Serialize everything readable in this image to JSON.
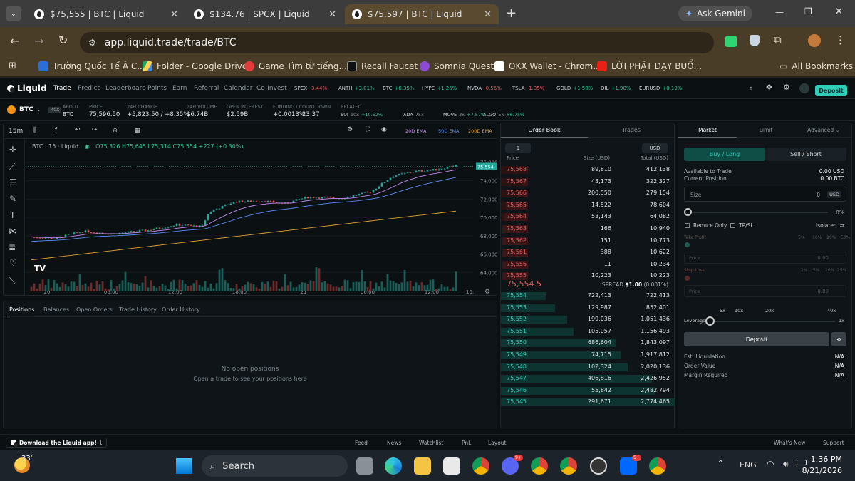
{
  "browser": {
    "tabs": [
      {
        "title": "$75,555 | BTC | Liquid"
      },
      {
        "title": "$134.76 | SPCX | Liquid"
      },
      {
        "title": "$75,597 | BTC | Liquid"
      }
    ],
    "ask_gemini": "Ask Gemini",
    "url": "app.liquid.trade/trade/BTC",
    "bookmarks": [
      "Trường Quốc Tế Á C...",
      "Folder - Google Drive",
      "Game Tìm từ tiếng...",
      "Recall Faucet",
      "Somnia Quest",
      "OKX Wallet - Chrom...",
      "LỜI PHẬT DẠY BUỔ..."
    ],
    "all_bookmarks": "All Bookmarks"
  },
  "nav": {
    "logo": "Liquid",
    "links": [
      "Trade",
      "Predict",
      "Leaderboard",
      "Points",
      "Earn",
      "Referral",
      "Calendar",
      "Co-Invest"
    ],
    "tickers": [
      {
        "sym": "SPCX",
        "chg": "-3.44%",
        "up": false
      },
      {
        "sym": "ANTH",
        "chg": "+3.01%",
        "up": true
      },
      {
        "sym": "BTC",
        "chg": "+8.35%",
        "up": true
      },
      {
        "sym": "HYPE",
        "chg": "+1.26%",
        "up": true
      },
      {
        "sym": "NVDA",
        "chg": "-0.56%",
        "up": false
      },
      {
        "sym": "TSLA",
        "chg": "-1.05%",
        "up": false
      },
      {
        "sym": "GOLD",
        "chg": "+1.58%",
        "up": true
      },
      {
        "sym": "OIL",
        "chg": "+1.90%",
        "up": true
      },
      {
        "sym": "EURUSD",
        "chg": "+0.19%",
        "up": true
      }
    ],
    "deposit": "Deposit"
  },
  "asset": {
    "sym": "BTC",
    "lev": "40X",
    "about_h": "ABOUT",
    "about_v": "BTC",
    "price_h": "PRICE",
    "price_v": "75,596.50",
    "chg_h": "24H CHANGE",
    "chg_v": "+5,823.50 / +8.35%",
    "vol_h": "24H VOLUME",
    "vol_v": "$6.74B",
    "oi_h": "OPEN INTEREST",
    "oi_v": "$2.59B",
    "fund_h": "FUNDING / COUNTDOWN",
    "fund_v": "+0.0013%",
    "fund_cd": "23:37",
    "rel_h": "RELATED",
    "related": [
      {
        "sym": "SUI",
        "lev": "10x",
        "chg": "+10.52%",
        "up": true
      },
      {
        "sym": "ADA",
        "lev": "75x",
        "chg": "",
        "up": true
      },
      {
        "sym": "MOVE",
        "lev": "3x",
        "chg": "+7.57%",
        "up": true
      },
      {
        "sym": "ALGO",
        "lev": "5x",
        "chg": "+6.75%",
        "up": true
      }
    ]
  },
  "chart": {
    "timeframe": "15m",
    "legend_title": "BTC · 15 · Liquid",
    "ohlc": "O75,326 H75,645 L75,314 C75,554 +227 (+0.30%)",
    "ema": [
      "20D EMA",
      "50D EMA",
      "200D EMA"
    ],
    "ema_colors": [
      "#c58cf0",
      "#5b8cf5",
      "#e0a23a"
    ],
    "price_tag": "75,554",
    "y_ticks": [
      "76,000",
      "74,000",
      "72,000",
      "70,000",
      "68,000",
      "66,000",
      "64,000"
    ],
    "x_ticks": [
      "20",
      "06:00",
      "12:00",
      "18:00",
      "21",
      "06:00",
      "12:00"
    ],
    "scale_label": "16:"
  },
  "bottom_tabs": [
    "Positions",
    "Balances",
    "Open Orders",
    "Trade History",
    "Order History"
  ],
  "empty": {
    "title": "No open positions",
    "sub": "Open a trade to see your positions here"
  },
  "orderbook": {
    "tabs": [
      "Order Book",
      "Trades"
    ],
    "group": "1",
    "currency": "USD",
    "cols": [
      "Price",
      "Size (USD)",
      "Total (USD)"
    ],
    "asks": [
      [
        "75,568",
        "89,810",
        "412,138",
        0.15
      ],
      [
        "75,567",
        "43,173",
        "322,327",
        0.12
      ],
      [
        "75,566",
        "200,550",
        "279,154",
        0.1
      ],
      [
        "75,565",
        "14,522",
        "78,604",
        0.03
      ],
      [
        "75,564",
        "53,143",
        "64,082",
        0.02
      ],
      [
        "75,563",
        "166",
        "10,940",
        0.0
      ],
      [
        "75,562",
        "151",
        "10,773",
        0.0
      ],
      [
        "75,561",
        "388",
        "10,622",
        0.0
      ],
      [
        "75,556",
        "11",
        "10,234",
        0.0
      ],
      [
        "75,555",
        "10,223",
        "10,223",
        0.0
      ]
    ],
    "mid": "75,554.5",
    "spread_label": "SPREAD",
    "spread_val": "$1.00",
    "spread_pct": "(0.001%)",
    "bids": [
      [
        "75,554",
        "722,413",
        "722,413",
        0.26
      ],
      [
        "75,553",
        "129,987",
        "852,401",
        0.31
      ],
      [
        "75,552",
        "199,036",
        "1,051,436",
        0.38
      ],
      [
        "75,551",
        "105,057",
        "1,156,493",
        0.42
      ],
      [
        "75,550",
        "686,604",
        "1,843,097",
        0.66
      ],
      [
        "75,549",
        "74,715",
        "1,917,812",
        0.69
      ],
      [
        "75,548",
        "102,324",
        "2,020,136",
        0.73
      ],
      [
        "75,547",
        "406,816",
        "2,426,952",
        0.87
      ],
      [
        "75,546",
        "55,842",
        "2,482,794",
        0.89
      ],
      [
        "75,545",
        "291,671",
        "2,774,465",
        1.0
      ]
    ]
  },
  "order": {
    "tabs": [
      "Market",
      "Limit",
      "Advanced"
    ],
    "buy": "Buy / Long",
    "sell": "Sell / Short",
    "avail_l": "Available to Trade",
    "avail_v": "0.00 USD",
    "pos_l": "Current Position",
    "pos_v": "0.00 BTC",
    "size_l": "Size",
    "size_v": "0",
    "size_cur": "USD",
    "slider_pct": "0%",
    "reduce": "Reduce Only",
    "tpsl": "TP/SL",
    "margin": "Isolated",
    "tp_l": "Take Profit",
    "tp_opts": [
      "5%",
      "10%",
      "20%",
      "50%"
    ],
    "sl_l": "Stop Loss",
    "sl_opts": [
      "2%",
      "5%",
      "10%",
      "25%"
    ],
    "price_l": "Price",
    "price_v": "0.00",
    "lev_ticks": [
      "5x",
      "10x",
      "20x",
      "40x"
    ],
    "lev_l": "Leverage",
    "lev_v": "1x",
    "deposit": "Deposit",
    "liq_l": "Est. Liquidation",
    "liq_v": "N/A",
    "ov_l": "Order Value",
    "ov_v": "N/A",
    "mr_l": "Margin Required",
    "mr_v": "N/A"
  },
  "footer": {
    "download": "Download the Liquid app!",
    "items": [
      "Feed",
      "News",
      "Watchlist",
      "PnL",
      "Layout"
    ],
    "whatsnew": "What's New",
    "support": "Support"
  },
  "taskbar": {
    "temp": "33°",
    "search": "Search",
    "lang": "ENG",
    "time": "1:36 PM",
    "date": "8/21/2026",
    "badges": [
      "9+",
      "5+"
    ]
  }
}
